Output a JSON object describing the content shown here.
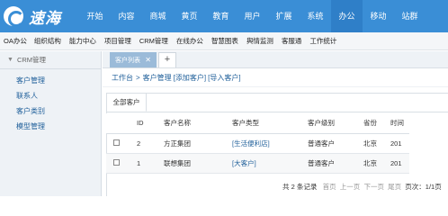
{
  "logo": {
    "text": "速海"
  },
  "topnav": [
    "开始",
    "内容",
    "商城",
    "黄页",
    "教育",
    "用户",
    "扩展",
    "系统",
    "办公",
    "移动",
    "站群"
  ],
  "topnav_active": 8,
  "subnav": [
    "OA办公",
    "组织结构",
    "能力中心",
    "项目管理",
    "CRM管理",
    "在线办公",
    "智慧图表",
    "舆情监测",
    "客服通",
    "工作统计"
  ],
  "sidebar": {
    "heading": "CRM管理",
    "items": [
      "客户管理",
      "联系人",
      "客户类别",
      "模型管理"
    ]
  },
  "tabs": {
    "active_label": "客户列表",
    "add": "+"
  },
  "breadcrumb": {
    "home": "工作台",
    "sep": ">",
    "page": "客户管理",
    "add_action": "[添加客户]",
    "import_action": "[导入客户]"
  },
  "panel": {
    "tab_label": "全部客户"
  },
  "table": {
    "headers": [
      "ID",
      "客户名称",
      "客户类型",
      "客户级别",
      "省份",
      "时间"
    ],
    "rows": [
      {
        "id": "2",
        "name": "方正集团",
        "type": "[生活便利店]",
        "level": "普通客户",
        "province": "北京",
        "time": "201"
      },
      {
        "id": "1",
        "name": "联想集团",
        "type": "[大客户]",
        "level": "普通客户",
        "province": "北京",
        "time": "201"
      }
    ]
  },
  "pager": {
    "summary": "共 2 条记录",
    "first": "首页",
    "prev": "上一页",
    "next": "下一页",
    "last": "尾页",
    "page": "页次：1/1页"
  },
  "colors": {
    "header": "#3a8ed6",
    "active_nav": "#2f7fc8",
    "link": "#1f5f9a",
    "tab": "#9bbbd9"
  }
}
